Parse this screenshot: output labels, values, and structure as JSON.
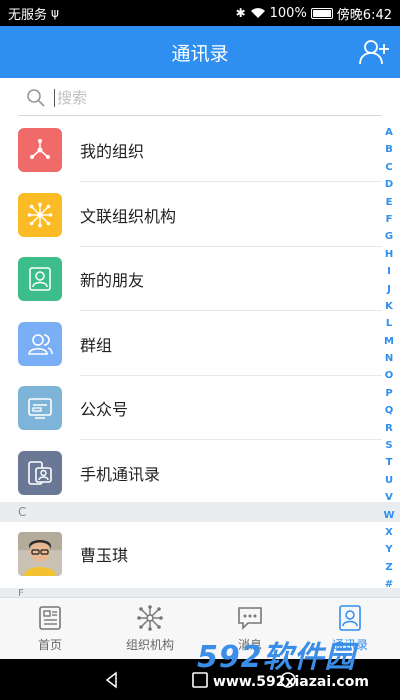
{
  "status_bar": {
    "carrier": "无服务",
    "usb": "ψ",
    "bluetooth": "✱",
    "battery_text": "100%",
    "battery_level": 1.0,
    "time": "傍晚6:42"
  },
  "header": {
    "title": "通讯录",
    "bg_color": "#2f8ff0"
  },
  "search": {
    "placeholder": "搜索",
    "value": ""
  },
  "menu_items": [
    {
      "label": "我的组织",
      "icon": "organization-icon",
      "color": "#f06a6a"
    },
    {
      "label": "文联组织机构",
      "icon": "network-icon",
      "color": "#fbbb24"
    },
    {
      "label": "新的朋友",
      "icon": "person-icon",
      "color": "#3dbd8a"
    },
    {
      "label": "群组",
      "icon": "group-icon",
      "color": "#7aaef5"
    },
    {
      "label": "公众号",
      "icon": "official-account-icon",
      "color": "#7eb4d8"
    },
    {
      "label": "手机通讯录",
      "icon": "phone-contacts-icon",
      "color": "#6a7896"
    }
  ],
  "sections": [
    {
      "letter": "C",
      "contacts": [
        {
          "name": "曹玉琪"
        }
      ]
    },
    {
      "letter": "F",
      "contacts": []
    }
  ],
  "alphabet": [
    "A",
    "B",
    "C",
    "D",
    "E",
    "F",
    "G",
    "H",
    "I",
    "J",
    "K",
    "L",
    "M",
    "N",
    "O",
    "P",
    "Q",
    "R",
    "S",
    "T",
    "U",
    "V",
    "W",
    "X",
    "Y",
    "Z",
    "#"
  ],
  "bottom_nav": [
    {
      "label": "首页",
      "icon": "home-icon",
      "active": false
    },
    {
      "label": "组织机构",
      "icon": "org-structure-icon",
      "active": false
    },
    {
      "label": "消息",
      "icon": "message-icon",
      "active": false
    },
    {
      "label": "通讯录",
      "icon": "contacts-icon",
      "active": true
    }
  ],
  "watermark": {
    "brand": "592软件园",
    "url": "www.592xiazai.com"
  }
}
